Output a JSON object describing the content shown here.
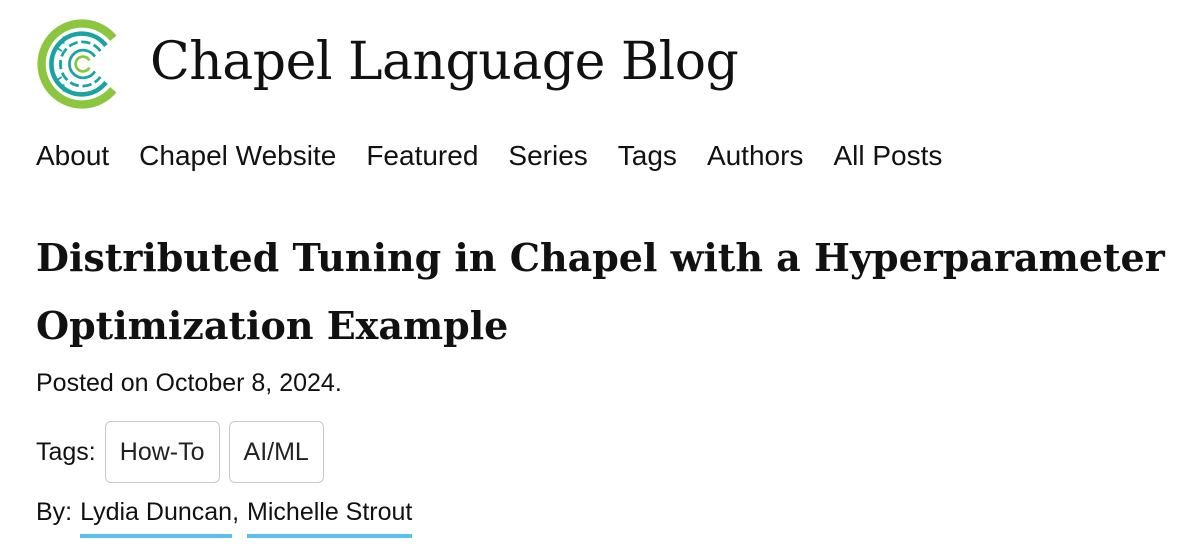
{
  "site": {
    "title": "Chapel Language Blog",
    "logo_icon": "chapel-logo-icon",
    "brand_green": "#8cc63f",
    "brand_teal": "#1aa3a3"
  },
  "nav": {
    "items": [
      {
        "label": "About"
      },
      {
        "label": "Chapel Website"
      },
      {
        "label": "Featured"
      },
      {
        "label": "Series"
      },
      {
        "label": "Tags"
      },
      {
        "label": "Authors"
      },
      {
        "label": "All Posts"
      }
    ]
  },
  "post": {
    "title": "Distributed Tuning in Chapel with a Hyperparameter Optimization Example",
    "posted": "Posted on October 8, 2024.",
    "tags_label": "Tags:",
    "tags": [
      "How-To",
      "AI/ML"
    ],
    "by_label": "By:",
    "authors": [
      "Lydia Duncan",
      "Michelle Strout"
    ],
    "author_separator": ",",
    "link_underline_color": "#5bc0eb"
  }
}
